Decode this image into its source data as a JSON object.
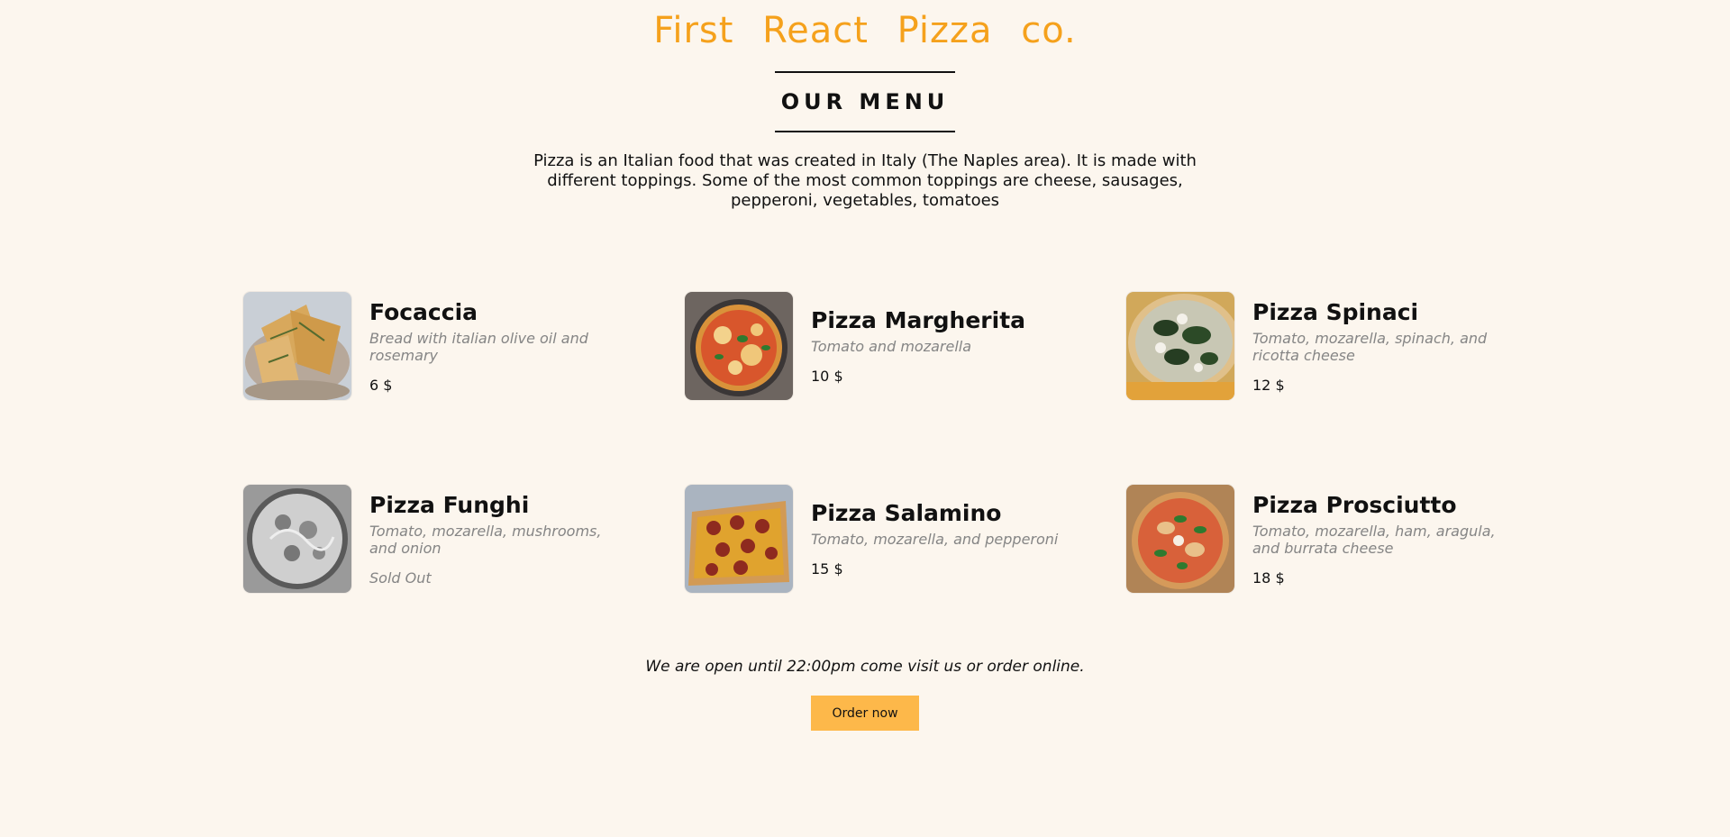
{
  "header": {
    "brand": "First React Pizza co.",
    "menu_title": "OUR MENU"
  },
  "intro": "Pizza is an Italian food that was created in Italy (The Naples area). It is made with different toppings. Some of the most common toppings are cheese, sausages, pepperoni, vegetables, tomatoes",
  "menu": {
    "items": [
      {
        "name": "Focaccia",
        "ingredients": "Bread with italian olive oil and rosemary",
        "price": "6 $",
        "image": "focaccia-photo"
      },
      {
        "name": "Pizza Margherita",
        "ingredients": "Tomato and mozarella",
        "price": "10 $",
        "image": "margherita-photo"
      },
      {
        "name": "Pizza Spinaci",
        "ingredients": "Tomato, mozarella, spinach, and ricotta cheese",
        "price": "12 $",
        "image": "spinaci-photo"
      },
      {
        "name": "Pizza Funghi",
        "ingredients": "Tomato, mozarella, mushrooms, and onion",
        "price": "Sold Out",
        "image": "funghi-photo"
      },
      {
        "name": "Pizza Salamino",
        "ingredients": "Tomato, mozarella, and pepperoni",
        "price": "15 $",
        "image": "salamino-photo"
      },
      {
        "name": "Pizza Prosciutto",
        "ingredients": "Tomato, mozarella, ham, aragula, and burrata cheese",
        "price": "18 $",
        "image": "prosciutto-photo"
      }
    ]
  },
  "footer": {
    "text": "We are open until 22:00pm come visit us or order online.",
    "button": "Order now"
  },
  "colors": {
    "brand": "#f5a11c",
    "background": "#fcf6ee",
    "button": "#fdb84a",
    "muted": "#858585"
  }
}
